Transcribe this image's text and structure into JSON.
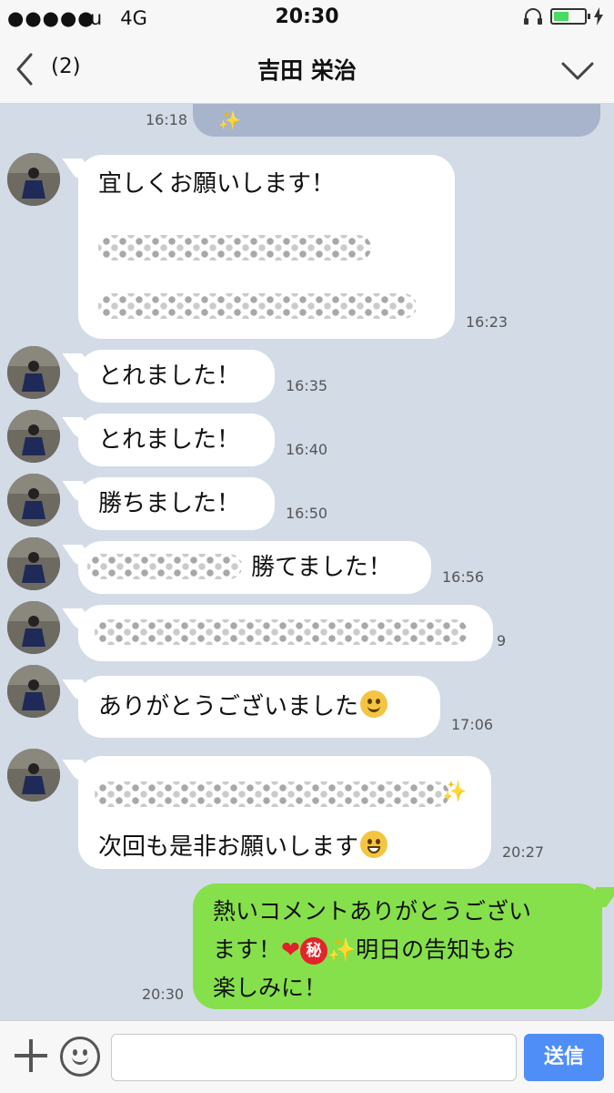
{
  "status_bar": {
    "signal": "●●●●●",
    "carrier": "au",
    "network": "4G",
    "time": "20:30"
  },
  "header": {
    "unread_count": "(2)",
    "title": "吉田 栄治"
  },
  "messages": [
    {
      "time": "16:18"
    },
    {
      "text": "宜しくお願いします！",
      "time": "16:23"
    },
    {
      "text": "とれました！",
      "time": "16:35"
    },
    {
      "text": "とれました！",
      "time": "16:40"
    },
    {
      "text": "勝ちました！",
      "time": "16:50"
    },
    {
      "text": "勝てました！",
      "time": "16:56"
    },
    {
      "time": "9"
    },
    {
      "text": "ありがとうございました",
      "time": "17:06"
    },
    {
      "text": "次回も是非お願いします",
      "time": "20:27"
    },
    {
      "line1": "熱いコメントありがとうござい",
      "line2a": "ます！",
      "line2b": "明日の告知もお",
      "line3": "楽しみに！",
      "secret_label": "秘",
      "time": "20:30"
    }
  ],
  "input": {
    "placeholder": "",
    "send_label": "送信"
  },
  "colors": {
    "chat_background": "#d3dbe7",
    "outgoing_bubble": "#86e04b",
    "incoming_bubble": "#ffffff",
    "send_button": "#4f8ef7"
  }
}
